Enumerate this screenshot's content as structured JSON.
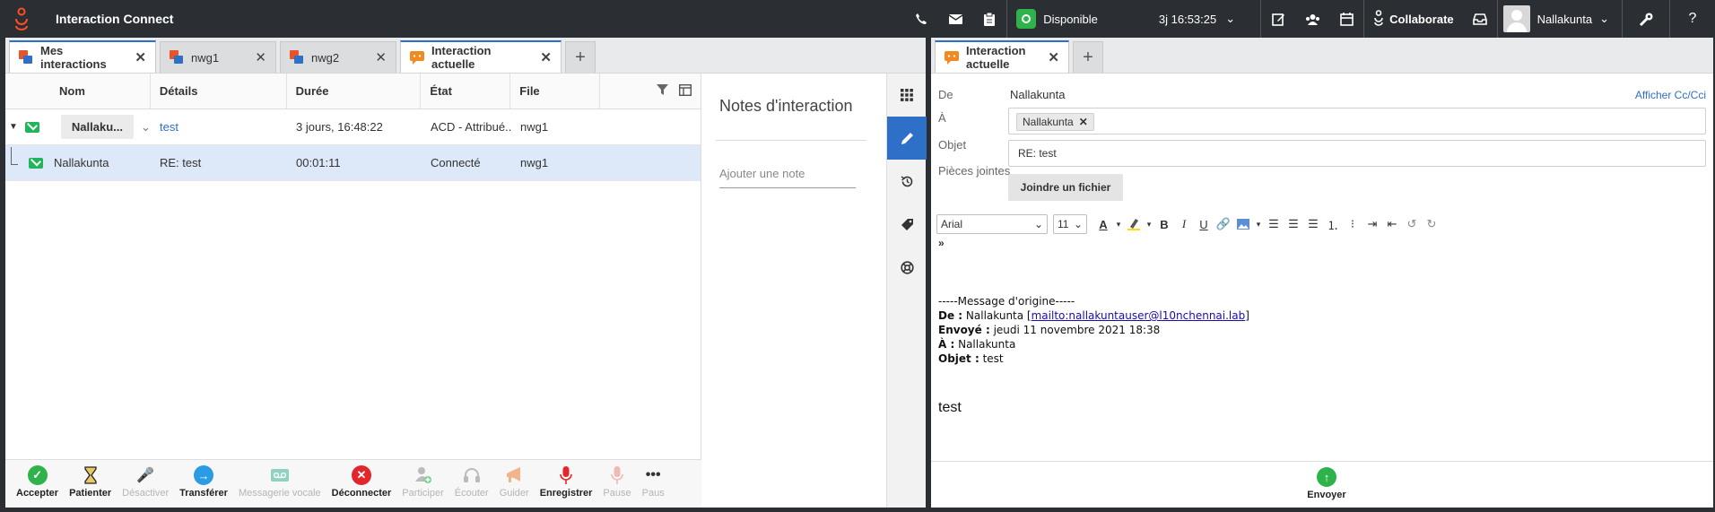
{
  "app": {
    "title": "Interaction Connect"
  },
  "topbar": {
    "status": "Disponible",
    "timer": "3j 16:53:25",
    "collaborate": "Collaborate",
    "user_name": "Nallakunta",
    "help": "?"
  },
  "left_tabs": [
    {
      "label": "Mes interactions"
    },
    {
      "label": "nwg1"
    },
    {
      "label": "nwg2"
    },
    {
      "label": "Interaction actuelle"
    }
  ],
  "grid": {
    "headers": {
      "name": "Nom",
      "details": "Détails",
      "duration": "Durée",
      "state": "État",
      "queue": "File"
    },
    "rows": [
      {
        "name": "Nallaku...",
        "details": "test",
        "duration": "3 jours, 16:48:22",
        "state": "ACD - Attribué...",
        "queue": "nwg1"
      },
      {
        "name": "Nallakunta",
        "details": "RE: test",
        "duration": "00:01:11",
        "state": "Connecté",
        "queue": "nwg1"
      }
    ]
  },
  "notes": {
    "title": "Notes d'interaction",
    "placeholder": "Ajouter une note"
  },
  "actions": [
    {
      "label": "Accepter",
      "icon": "check-circle-icon",
      "color": "#2db34a",
      "enabled": true
    },
    {
      "label": "Patienter",
      "icon": "hourglass-icon",
      "enabled": true
    },
    {
      "label": "Désactiver",
      "icon": "mute-icon",
      "enabled": false
    },
    {
      "label": "Transférer",
      "icon": "arrow-right-circle-icon",
      "color": "#2b9be3",
      "enabled": true
    },
    {
      "label": "Messagerie vocale",
      "icon": "voicemail-icon",
      "enabled": false
    },
    {
      "label": "Déconnecter",
      "icon": "x-circle-icon",
      "color": "#e3262b",
      "enabled": true
    },
    {
      "label": "Participer",
      "icon": "add-user-icon",
      "enabled": false
    },
    {
      "label": "Écouter",
      "icon": "headset-icon",
      "enabled": false
    },
    {
      "label": "Guider",
      "icon": "megaphone-icon",
      "enabled": false
    },
    {
      "label": "Enregistrer",
      "icon": "microphone-icon",
      "color": "#e3262b",
      "enabled": true
    },
    {
      "label": "Pause",
      "icon": "microphone-icon",
      "enabled": false
    },
    {
      "label": "Paus",
      "icon": "more-icon",
      "enabled": false
    }
  ],
  "right_tabs": [
    {
      "label": "Interaction actuelle"
    }
  ],
  "email": {
    "from_label": "De",
    "from_value": "Nallakunta",
    "show_cc": "Afficher Cc/Cci",
    "to_label": "À",
    "to_chip": "Nallakunta",
    "subject_label": "Objet",
    "subject_value": "RE: test",
    "attach_label": "Pièces jointes",
    "attach_button": "Joindre un fichier",
    "font": "Arial",
    "font_size": "11",
    "original_header": "-----Message d'origine-----",
    "orig_from_label": "De :",
    "orig_from_name": "Nallakunta",
    "orig_from_link": "mailto:nallakuntauser@l10nchennai.lab",
    "orig_sent_label": "Envoyé :",
    "orig_sent_value": "jeudi 11 novembre 2021 18:38",
    "orig_to_label": "À :",
    "orig_to_value": "Nallakunta",
    "orig_subject_label": "Objet :",
    "orig_subject_value": "test",
    "body": "test",
    "send": "Envoyer"
  }
}
